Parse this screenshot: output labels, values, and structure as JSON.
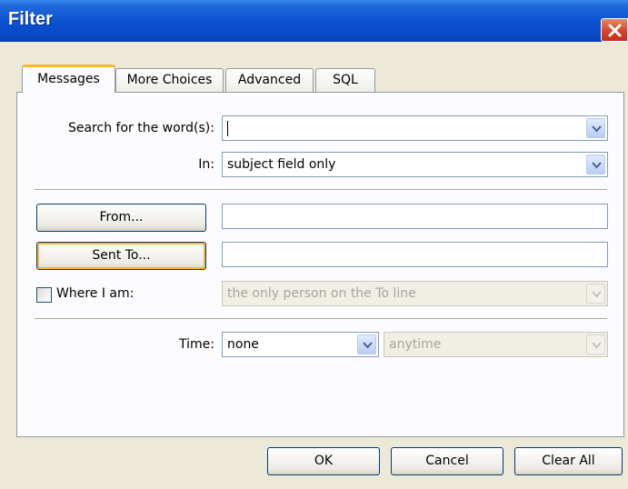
{
  "window": {
    "title": "Filter"
  },
  "tabs": [
    {
      "label": "Messages",
      "active": true
    },
    {
      "label": "More Choices",
      "active": false
    },
    {
      "label": "Advanced",
      "active": false
    },
    {
      "label": "SQL",
      "active": false
    }
  ],
  "search": {
    "label": "Search for the word(s):",
    "value": ""
  },
  "in": {
    "label": "In:",
    "value": "subject field only"
  },
  "from": {
    "button_label": "From...",
    "value": ""
  },
  "sent_to": {
    "button_label": "Sent To...",
    "value": ""
  },
  "where_i_am": {
    "label": "Where I am:",
    "checked": false,
    "value": "the only person on the To line"
  },
  "time": {
    "label": "Time:",
    "value": "none",
    "range_value": "anytime"
  },
  "buttons": {
    "ok": "OK",
    "cancel": "Cancel",
    "clear_all": "Clear All"
  },
  "colors": {
    "titlebar": "#0848c5",
    "dialog": "#ece9d8",
    "tab_highlight": "#f7b82c",
    "close": "#d5442a"
  },
  "icons": {
    "close": "close-icon",
    "dropdown": "chevron-down-icon"
  }
}
